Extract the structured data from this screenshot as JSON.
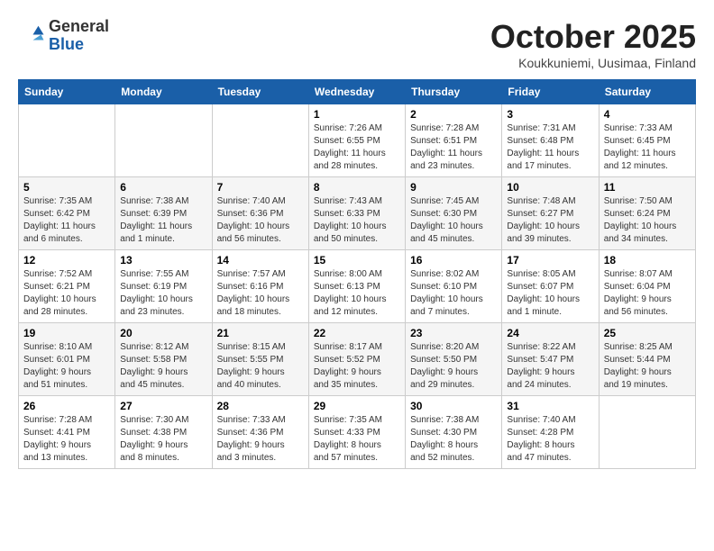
{
  "header": {
    "logo_general": "General",
    "logo_blue": "Blue",
    "title": "October 2025",
    "subtitle": "Koukkuniemi, Uusimaa, Finland"
  },
  "weekdays": [
    "Sunday",
    "Monday",
    "Tuesday",
    "Wednesday",
    "Thursday",
    "Friday",
    "Saturday"
  ],
  "weeks": [
    [
      {
        "day": "",
        "info": ""
      },
      {
        "day": "",
        "info": ""
      },
      {
        "day": "",
        "info": ""
      },
      {
        "day": "1",
        "info": "Sunrise: 7:26 AM\nSunset: 6:55 PM\nDaylight: 11 hours\nand 28 minutes."
      },
      {
        "day": "2",
        "info": "Sunrise: 7:28 AM\nSunset: 6:51 PM\nDaylight: 11 hours\nand 23 minutes."
      },
      {
        "day": "3",
        "info": "Sunrise: 7:31 AM\nSunset: 6:48 PM\nDaylight: 11 hours\nand 17 minutes."
      },
      {
        "day": "4",
        "info": "Sunrise: 7:33 AM\nSunset: 6:45 PM\nDaylight: 11 hours\nand 12 minutes."
      }
    ],
    [
      {
        "day": "5",
        "info": "Sunrise: 7:35 AM\nSunset: 6:42 PM\nDaylight: 11 hours\nand 6 minutes."
      },
      {
        "day": "6",
        "info": "Sunrise: 7:38 AM\nSunset: 6:39 PM\nDaylight: 11 hours\nand 1 minute."
      },
      {
        "day": "7",
        "info": "Sunrise: 7:40 AM\nSunset: 6:36 PM\nDaylight: 10 hours\nand 56 minutes."
      },
      {
        "day": "8",
        "info": "Sunrise: 7:43 AM\nSunset: 6:33 PM\nDaylight: 10 hours\nand 50 minutes."
      },
      {
        "day": "9",
        "info": "Sunrise: 7:45 AM\nSunset: 6:30 PM\nDaylight: 10 hours\nand 45 minutes."
      },
      {
        "day": "10",
        "info": "Sunrise: 7:48 AM\nSunset: 6:27 PM\nDaylight: 10 hours\nand 39 minutes."
      },
      {
        "day": "11",
        "info": "Sunrise: 7:50 AM\nSunset: 6:24 PM\nDaylight: 10 hours\nand 34 minutes."
      }
    ],
    [
      {
        "day": "12",
        "info": "Sunrise: 7:52 AM\nSunset: 6:21 PM\nDaylight: 10 hours\nand 28 minutes."
      },
      {
        "day": "13",
        "info": "Sunrise: 7:55 AM\nSunset: 6:19 PM\nDaylight: 10 hours\nand 23 minutes."
      },
      {
        "day": "14",
        "info": "Sunrise: 7:57 AM\nSunset: 6:16 PM\nDaylight: 10 hours\nand 18 minutes."
      },
      {
        "day": "15",
        "info": "Sunrise: 8:00 AM\nSunset: 6:13 PM\nDaylight: 10 hours\nand 12 minutes."
      },
      {
        "day": "16",
        "info": "Sunrise: 8:02 AM\nSunset: 6:10 PM\nDaylight: 10 hours\nand 7 minutes."
      },
      {
        "day": "17",
        "info": "Sunrise: 8:05 AM\nSunset: 6:07 PM\nDaylight: 10 hours\nand 1 minute."
      },
      {
        "day": "18",
        "info": "Sunrise: 8:07 AM\nSunset: 6:04 PM\nDaylight: 9 hours\nand 56 minutes."
      }
    ],
    [
      {
        "day": "19",
        "info": "Sunrise: 8:10 AM\nSunset: 6:01 PM\nDaylight: 9 hours\nand 51 minutes."
      },
      {
        "day": "20",
        "info": "Sunrise: 8:12 AM\nSunset: 5:58 PM\nDaylight: 9 hours\nand 45 minutes."
      },
      {
        "day": "21",
        "info": "Sunrise: 8:15 AM\nSunset: 5:55 PM\nDaylight: 9 hours\nand 40 minutes."
      },
      {
        "day": "22",
        "info": "Sunrise: 8:17 AM\nSunset: 5:52 PM\nDaylight: 9 hours\nand 35 minutes."
      },
      {
        "day": "23",
        "info": "Sunrise: 8:20 AM\nSunset: 5:50 PM\nDaylight: 9 hours\nand 29 minutes."
      },
      {
        "day": "24",
        "info": "Sunrise: 8:22 AM\nSunset: 5:47 PM\nDaylight: 9 hours\nand 24 minutes."
      },
      {
        "day": "25",
        "info": "Sunrise: 8:25 AM\nSunset: 5:44 PM\nDaylight: 9 hours\nand 19 minutes."
      }
    ],
    [
      {
        "day": "26",
        "info": "Sunrise: 7:28 AM\nSunset: 4:41 PM\nDaylight: 9 hours\nand 13 minutes."
      },
      {
        "day": "27",
        "info": "Sunrise: 7:30 AM\nSunset: 4:38 PM\nDaylight: 9 hours\nand 8 minutes."
      },
      {
        "day": "28",
        "info": "Sunrise: 7:33 AM\nSunset: 4:36 PM\nDaylight: 9 hours\nand 3 minutes."
      },
      {
        "day": "29",
        "info": "Sunrise: 7:35 AM\nSunset: 4:33 PM\nDaylight: 8 hours\nand 57 minutes."
      },
      {
        "day": "30",
        "info": "Sunrise: 7:38 AM\nSunset: 4:30 PM\nDaylight: 8 hours\nand 52 minutes."
      },
      {
        "day": "31",
        "info": "Sunrise: 7:40 AM\nSunset: 4:28 PM\nDaylight: 8 hours\nand 47 minutes."
      },
      {
        "day": "",
        "info": ""
      }
    ]
  ]
}
